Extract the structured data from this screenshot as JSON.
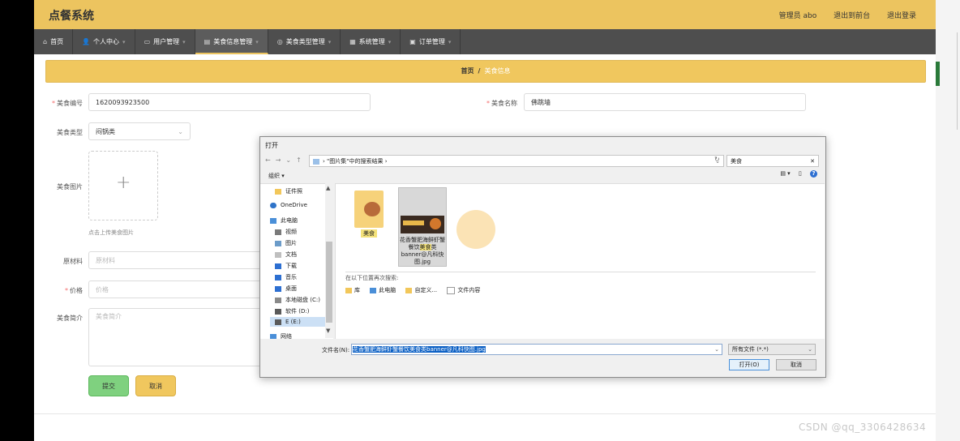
{
  "app": {
    "title": "点餐系统",
    "user_label": "管理员 abo",
    "back_label": "退出到前台",
    "logout_label": "退出登录"
  },
  "nav": [
    {
      "label": "首页",
      "icon": "home-icon"
    },
    {
      "label": "个人中心",
      "icon": "user-icon"
    },
    {
      "label": "用户管理",
      "icon": "user-manage-icon"
    },
    {
      "label": "美食信息管理",
      "icon": "food-icon",
      "active": true
    },
    {
      "label": "美食类型管理",
      "icon": "category-icon"
    },
    {
      "label": "系统管理",
      "icon": "system-icon"
    },
    {
      "label": "订单管理",
      "icon": "order-icon"
    }
  ],
  "breadcrumb": {
    "home": "首页",
    "sep": "/",
    "current": "美食信息"
  },
  "form": {
    "code_label": "美食编号",
    "code_value": "1620093923500",
    "name_label": "美食名称",
    "name_value": "佛跳墙",
    "type_label": "美食类型",
    "type_value": "闷锅类",
    "image_label": "美食图片",
    "upload_hint": "点击上传美食图片",
    "material_label": "原材料",
    "material_placeholder": "原材料",
    "price_label": "价格",
    "price_placeholder": "价格",
    "intro_label": "美食简介",
    "intro_placeholder": "美食简介",
    "submit_label": "提交",
    "cancel_label": "取消"
  },
  "dialog": {
    "title": "打开",
    "path_label": "\"图片集\"中的搜索结果",
    "search_value": "美食",
    "organize_label": "组织",
    "tree": [
      {
        "label": "证件照",
        "icon": "folder-icon"
      },
      {
        "label": "OneDrive",
        "icon": "cloud-icon"
      },
      {
        "label": "此电脑",
        "icon": "computer-icon"
      },
      {
        "label": "视频",
        "icon": "video-icon"
      },
      {
        "label": "图片",
        "icon": "picture-icon"
      },
      {
        "label": "文档",
        "icon": "document-icon"
      },
      {
        "label": "下载",
        "icon": "download-icon"
      },
      {
        "label": "音乐",
        "icon": "music-icon"
      },
      {
        "label": "桌面",
        "icon": "desktop-icon"
      },
      {
        "label": "本地磁盘 (C:)",
        "icon": "disk-icon"
      },
      {
        "label": "软件 (D:)",
        "icon": "disk-icon"
      },
      {
        "label": "E (E:)",
        "icon": "disk-icon"
      },
      {
        "label": "网络",
        "icon": "network-icon"
      }
    ],
    "folder_name": "美食",
    "file_name_prefix": "花香蟹肥海鲜虾蟹餐饮",
    "file_name_highlight": "美食",
    "file_name_suffix": "类banner@凡科快图.jpg",
    "search_again_label": "在以下位置再次搜索:",
    "search_again_links": [
      "库",
      "此电脑",
      "自定义...",
      "文件内容"
    ],
    "filename_label": "文件名(N):",
    "filename_value": "花香蟹肥海鲜虾蟹餐饮美食类banner@凡科快图.jpg",
    "filetype_value": "所有文件 (*.*)",
    "open_label": "打开(O)",
    "cancel_label": "取消"
  },
  "watermark": "CSDN @qq_3306428634"
}
